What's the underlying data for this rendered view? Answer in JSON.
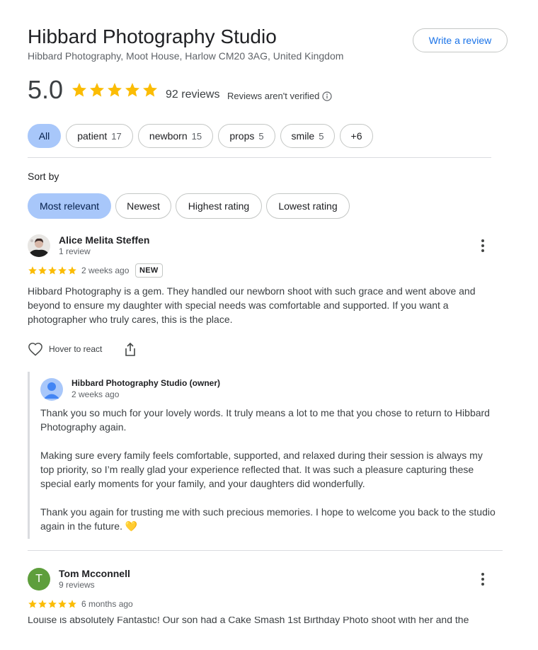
{
  "header": {
    "title": "Hibbard Photography Studio",
    "address": "Hibbard Photography, Moot House, Harlow CM20 3AG, United Kingdom",
    "write_review": "Write a review"
  },
  "summary": {
    "rating": "5.0",
    "stars": 5,
    "reviews_count": "92 reviews",
    "not_verified": "Reviews aren't verified"
  },
  "filters": [
    {
      "label": "All",
      "count": ""
    },
    {
      "label": "patient",
      "count": "17"
    },
    {
      "label": "newborn",
      "count": "15"
    },
    {
      "label": "props",
      "count": "5"
    },
    {
      "label": "smile",
      "count": "5"
    },
    {
      "label": "+6",
      "count": ""
    }
  ],
  "sort": {
    "label": "Sort by",
    "options": [
      "Most relevant",
      "Newest",
      "Highest rating",
      "Lowest rating"
    ],
    "selected": "Most relevant"
  },
  "reviews": [
    {
      "name": "Alice Melita Steffen",
      "meta": "1 review",
      "stars": 5,
      "time": "2 weeks ago",
      "badge": "NEW",
      "text": "Hibbard Photography is a gem. They handled our newborn shoot with such grace and went above and beyond to ensure my daughter with special needs was comfortable and supported. If you want a photographer who truly cares, this is the place.",
      "react": "Hover to react",
      "owner": {
        "name": "Hibbard Photography Studio (owner)",
        "time": "2 weeks ago",
        "p1": "Thank you so much for your lovely words. It truly means a lot to me that you chose to return to Hibbard Photography again.",
        "p2": "Making sure every family feels comfortable, supported, and relaxed during their session is always my top priority, so I’m really glad your experience reflected that. It was such a pleasure capturing these special early moments for your family, and your daughters did wonderfully.",
        "p3": "Thank you again for trusting me with such precious memories. I hope to welcome you back to the studio again in the future. 💛"
      }
    },
    {
      "name": "Tom Mcconnell",
      "initial": "T",
      "meta": "9 reviews",
      "stars": 5,
      "time": "6 months ago",
      "text": "Louise is absolutely Fantastic! Our son had a Cake Smash 1st Birthday Photo shoot with her and the"
    }
  ],
  "colors": {
    "accent": "#1a73e8",
    "star": "#fbbc04",
    "chip_active": "#a8c7fa",
    "avatar_green": "#5e9e3c"
  }
}
